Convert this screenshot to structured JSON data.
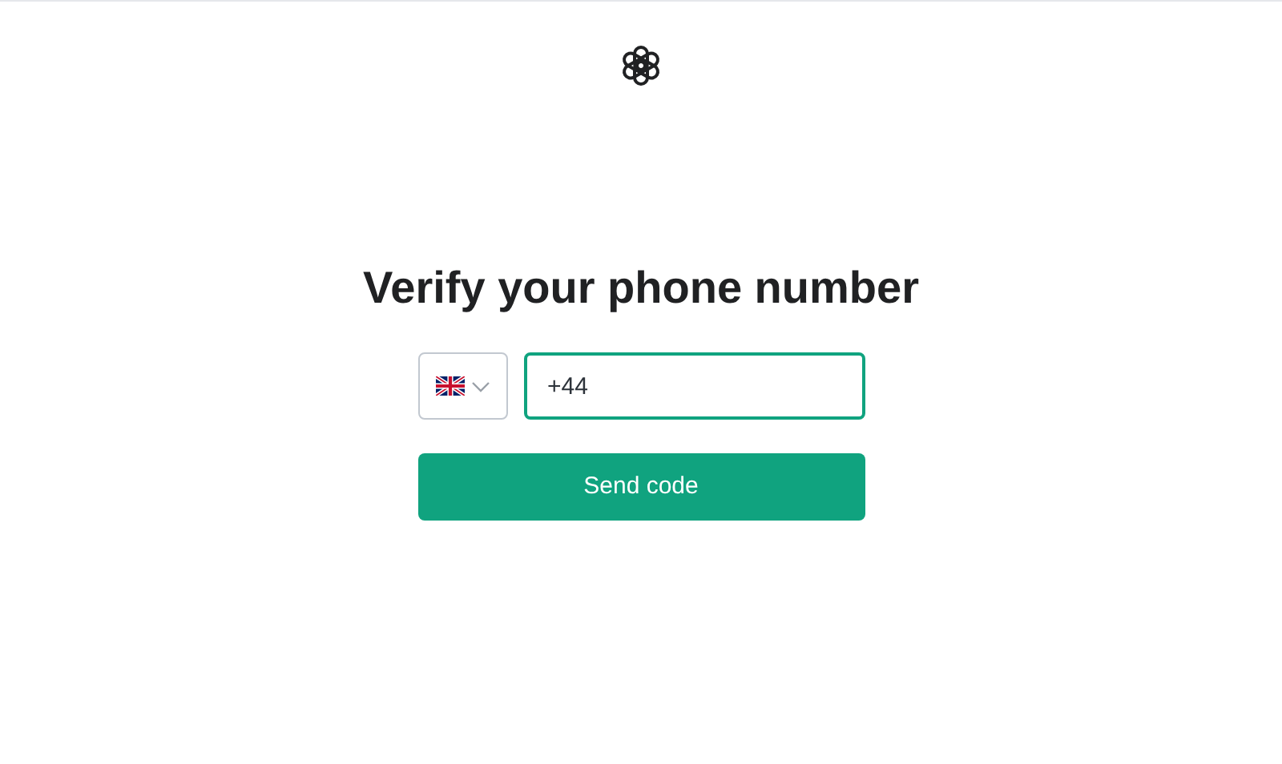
{
  "heading": "Verify your phone number",
  "phone": {
    "value": "+44",
    "focused": true
  },
  "send_button": {
    "label": "Send code"
  }
}
